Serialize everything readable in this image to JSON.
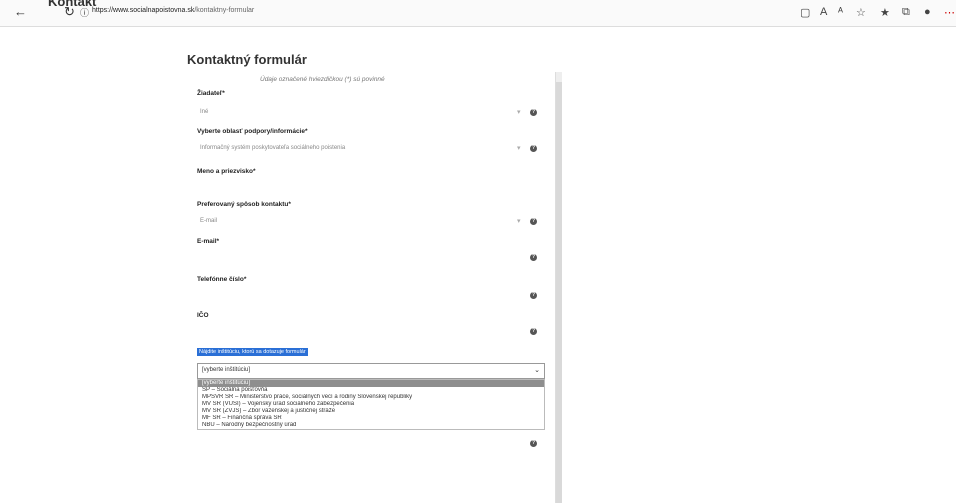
{
  "browser": {
    "back_icon": "arrow-left-icon",
    "reload_icon": "reload-icon",
    "info_icon": "info-icon",
    "url_host": "https://www.socialnapoistovna.sk",
    "url_path": "/kontaktny-formular",
    "tab_fragment": "Kontakt",
    "extension_icons": [
      "read-aloud-icon",
      "translate-icon",
      "font-size-icon",
      "favorite-icon",
      "favorites-bar-icon",
      "collections-icon",
      "profile-icon",
      "more-icon"
    ]
  },
  "form": {
    "title": "Kontaktný formulár",
    "hint": "Údaje označené hviezdičkou (*) sú povinné",
    "fields": {
      "ziadatel_label": "Žiadateľ*",
      "ziadatel_value": "Iné",
      "oblast_label": "Vyberte oblasť podpory/informácie*",
      "oblast_value": "Informačný systém poskytovateľa sociálneho poistenia",
      "meno_label": "Meno a priezvisko*",
      "sposob_label": "Preferovaný spôsob kontaktu*",
      "sposob_value": "E-mail",
      "email_label": "E-mail*",
      "telefon_label": "Telefónne číslo*",
      "ico_label": "IČO"
    },
    "institution": {
      "helper": "Nájdite inštitúciu, ktorú sa dotazuje formulár",
      "selected": "[vyberte inštitúciu]",
      "options": [
        "[vyberte inštitúciu]",
        "SP – Sociálna poisťovňa",
        "MPSVR SR – Ministerstvo práce, sociálnych vecí a rodiny Slovenskej republiky",
        "MV SR (VÚSI) – Vojenský úrad sociálneho zabezpečenia",
        "MV SR (ZVJS) – Zbor väzenskej a justičnej stráže",
        "MF SR – Finančná správa SR",
        "NBÚ – Národný bezpečnostný úrad"
      ]
    }
  },
  "colors": {
    "helper_bg": "#2a6fd6",
    "selected_option_bg": "#8e8e8e"
  }
}
